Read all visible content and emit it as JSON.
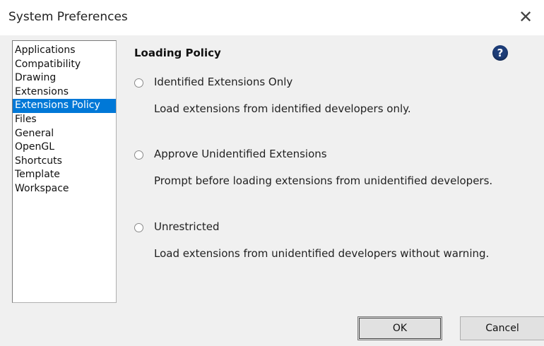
{
  "window": {
    "title": "System Preferences",
    "close_glyph": "✕"
  },
  "sidebar": {
    "items": [
      {
        "label": "Applications",
        "selected": false
      },
      {
        "label": "Compatibility",
        "selected": false
      },
      {
        "label": "Drawing",
        "selected": false
      },
      {
        "label": "Extensions",
        "selected": false
      },
      {
        "label": "Extensions Policy",
        "selected": true
      },
      {
        "label": "Files",
        "selected": false
      },
      {
        "label": "General",
        "selected": false
      },
      {
        "label": "OpenGL",
        "selected": false
      },
      {
        "label": "Shortcuts",
        "selected": false
      },
      {
        "label": "Template",
        "selected": false
      },
      {
        "label": "Workspace",
        "selected": false
      }
    ],
    "selected_color": "#0078d7"
  },
  "main": {
    "section_title": "Loading Policy",
    "help_glyph": "?",
    "options": [
      {
        "label": "Identified Extensions Only",
        "description": "Load extensions from identified developers only.",
        "checked": false
      },
      {
        "label": "Approve Unidentified Extensions",
        "description": "Prompt before loading extensions from unidentified developers.",
        "checked": false
      },
      {
        "label": "Unrestricted",
        "description": "Load extensions from unidentified developers without warning.",
        "checked": false
      }
    ]
  },
  "buttons": {
    "ok_label": "OK",
    "cancel_label": "Cancel"
  },
  "colors": {
    "help_icon": "#1d3d78",
    "window_bg": "#f0f0f0"
  }
}
